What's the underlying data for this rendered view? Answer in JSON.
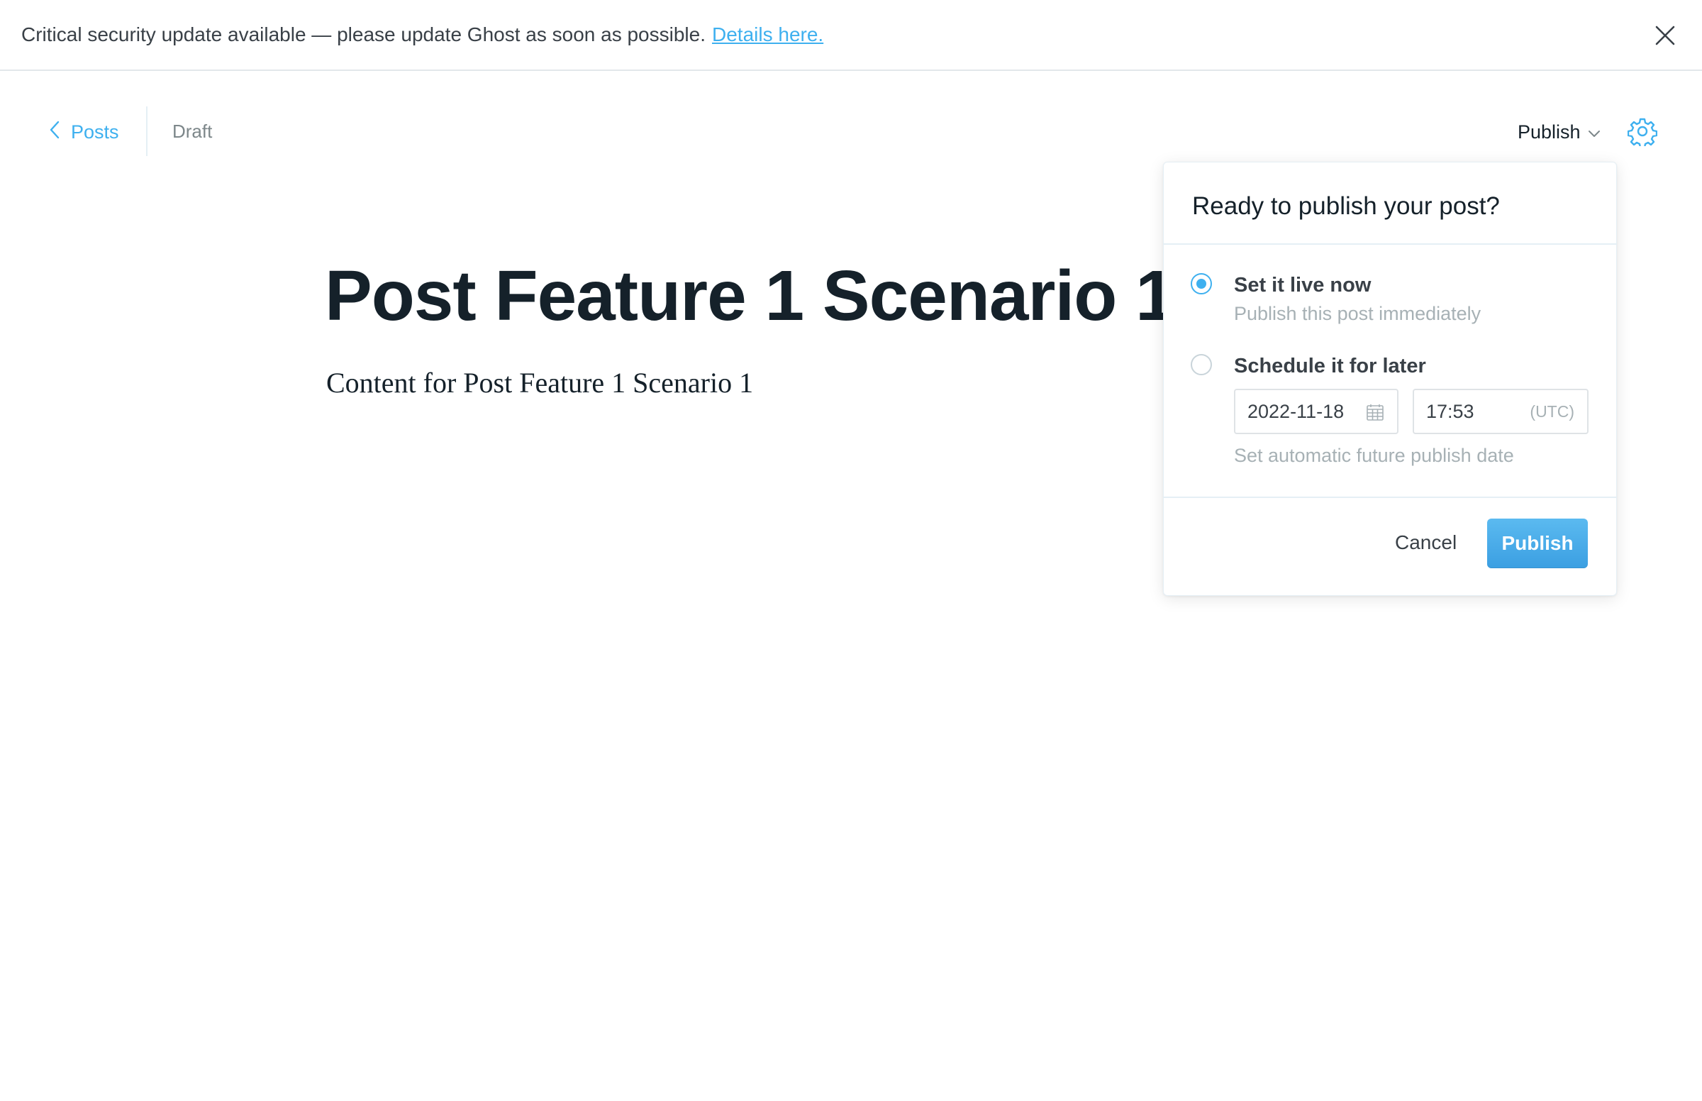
{
  "banner": {
    "message": "Critical security update available — please update Ghost as soon as possible.",
    "link_text": "Details here."
  },
  "header": {
    "back_label": "Posts",
    "status": "Draft",
    "publish_menu_label": "Publish"
  },
  "post": {
    "title": "Post Feature 1 Scenario 1",
    "body": "Content for Post Feature 1 Scenario 1"
  },
  "publish_dropdown": {
    "title": "Ready to publish your post?",
    "options": [
      {
        "label": "Set it live now",
        "description": "Publish this post immediately",
        "selected": true
      },
      {
        "label": "Schedule it for later",
        "description": "Set automatic future publish date",
        "selected": false
      }
    ],
    "date_value": "2022-11-18",
    "time_value": "17:53",
    "timezone": "(UTC)",
    "cancel_label": "Cancel",
    "publish_label": "Publish"
  },
  "colors": {
    "accent": "#3eb0ef",
    "text": "#15212a",
    "muted": "#a7b1b5"
  },
  "icons": {
    "close": "close-icon",
    "back": "chevron-left-icon",
    "dropdown": "chevron-down-icon",
    "settings": "gear-icon",
    "calendar": "calendar-icon"
  }
}
